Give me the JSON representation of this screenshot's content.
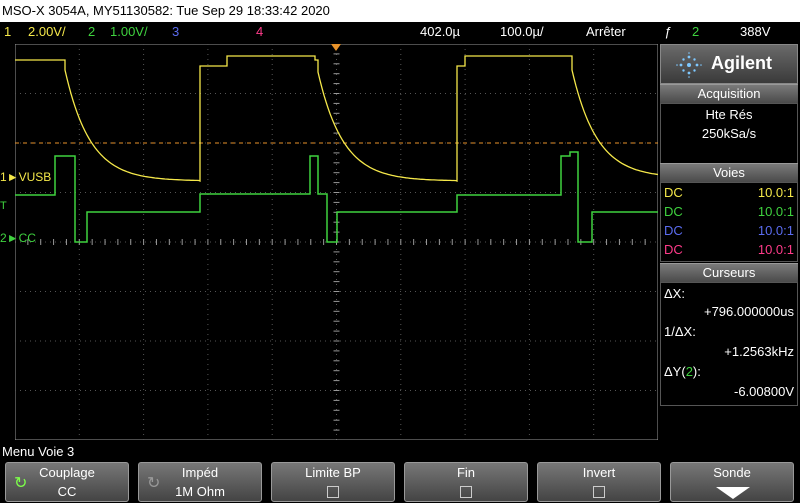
{
  "title": "MSO-X 3054A, MY51130582: Tue Sep 29 18:33:42 2020",
  "status": {
    "ch1": {
      "num": "1",
      "scale": "2.00V/",
      "color": "#f5e84a"
    },
    "ch2": {
      "num": "2",
      "scale": "1.00V/",
      "color": "#3fd23f"
    },
    "ch3": {
      "num": "3",
      "color": "#5b6cf0"
    },
    "ch4": {
      "num": "4",
      "color": "#ff3b8a"
    },
    "timebase": "402.0µ",
    "time_scale": "100.0µ/",
    "run_state": "Arrêter",
    "trigger_icon": "ƒ",
    "trigger_channel": "2",
    "trigger_level": "388V"
  },
  "markers": {
    "ch1_label": "VUSB",
    "ch2_label": "CC",
    "ch1_num": "1",
    "ch2_num": "2",
    "trigger_mark": "T"
  },
  "panel": {
    "brand": "Agilent",
    "acquisition": {
      "title": "Acquisition",
      "mode": "Hte Rés",
      "rate": "250kSa/s"
    },
    "voies": {
      "title": "Voies",
      "rows": [
        {
          "coupling": "DC",
          "ratio": "10.0:1",
          "color": "#f5e84a"
        },
        {
          "coupling": "DC",
          "ratio": "10.0:1",
          "color": "#3fd23f"
        },
        {
          "coupling": "DC",
          "ratio": "10.0:1",
          "color": "#5b6cf0"
        },
        {
          "coupling": "DC",
          "ratio": "10.0:1",
          "color": "#ff3b8a"
        }
      ]
    },
    "cursors": {
      "title": "Curseurs",
      "dx_label": "ΔX:",
      "dx_value": "+796.000000us",
      "inv_label": "1/ΔX:",
      "inv_value": "+1.2563kHz",
      "dy_label": "ΔY(",
      "dy_ch": "2",
      "dy_close": "):",
      "dy_value": "-6.00800V"
    }
  },
  "menu": {
    "title": "Menu Voie 3",
    "softkeys": [
      {
        "label": "Couplage",
        "value": "CC"
      },
      {
        "label": "Impéd",
        "value": "1M Ohm"
      },
      {
        "label": "Limite BP"
      },
      {
        "label": "Fin"
      },
      {
        "label": "Invert"
      },
      {
        "label": "Sonde"
      }
    ]
  },
  "waveforms": {
    "ch1_color": "#f5e84a",
    "ch2_color": "#3fd23f",
    "trigger_line_color": "#e8922a"
  }
}
